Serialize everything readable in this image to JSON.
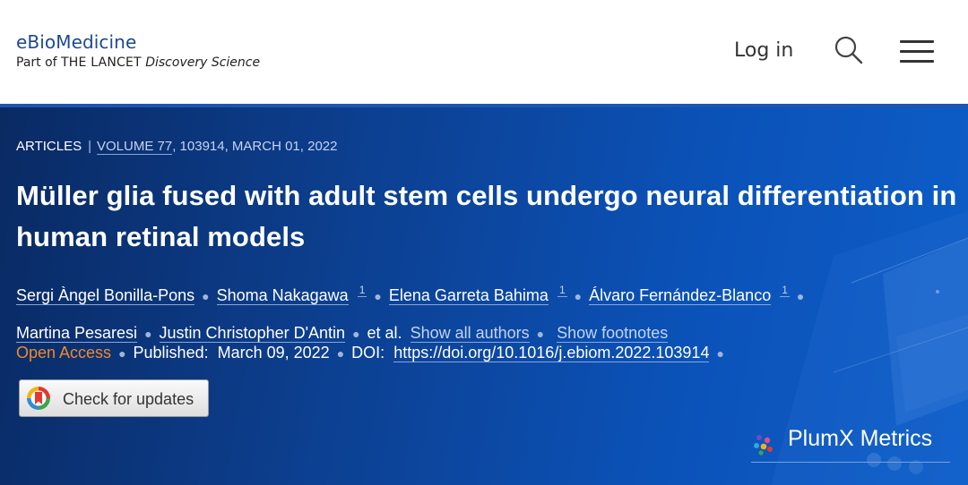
{
  "header": {
    "journal_name": "eBioMedicine",
    "part_of_prefix": "Part of",
    "lancet": "THE LANCET",
    "discovery_science": "Discovery Science",
    "login_label": "Log in",
    "search_icon": "search-icon",
    "menu_icon": "hamburger-menu-icon"
  },
  "article": {
    "section": "ARTICLES",
    "separator": "|",
    "volume": "VOLUME 77",
    "issue_info": ", 103914, MARCH 01, 2022",
    "title": "Müller glia fused with adult stem cells undergo neural differentiation in human retinal models",
    "authors": [
      {
        "name": "Sergi Àngel Bonilla-Pons",
        "sup": ""
      },
      {
        "name": "Shoma Nakagawa",
        "sup": "1"
      },
      {
        "name": "Elena Garreta Bahima",
        "sup": "1"
      },
      {
        "name": "Álvaro Fernández-Blanco",
        "sup": "1"
      },
      {
        "name": "Martina Pesaresi",
        "sup": ""
      },
      {
        "name": "Justin Christopher D'Antin",
        "sup": ""
      }
    ],
    "et_al": "et al.",
    "show_all_authors": "Show all authors",
    "show_footnotes": "Show footnotes",
    "open_access": "Open Access",
    "published_label": "Published:",
    "published_date": "March 09, 2022",
    "doi_label": "DOI:",
    "doi_link": "https://doi.org/10.1016/j.ebiom.2022.103914",
    "check_updates": "Check for updates",
    "plumx": "PlumX Metrics"
  },
  "colors": {
    "brand_blue": "#1d4a8f",
    "banner_blue": "#0c3f8f",
    "open_access_orange": "#f08a2c"
  }
}
